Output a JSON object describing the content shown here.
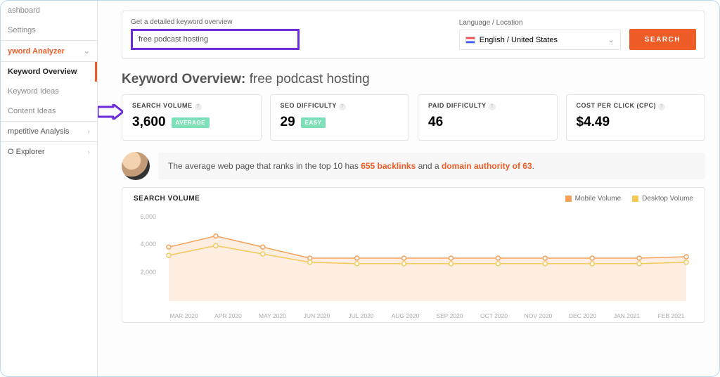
{
  "sidebar": {
    "items": [
      {
        "label": "ashboard"
      },
      {
        "label": "Settings"
      },
      {
        "label": "yword Analyzer"
      },
      {
        "label": "Keyword Overview"
      },
      {
        "label": "Keyword Ideas"
      },
      {
        "label": "Content Ideas"
      },
      {
        "label": "mpetitive Analysis"
      },
      {
        "label": "O Explorer"
      }
    ]
  },
  "search": {
    "prompt": "Get a detailed keyword overview",
    "value": "free podcast hosting",
    "lang_label": "Language / Location",
    "lang_value": "English / United States",
    "button": "SEARCH"
  },
  "heading": {
    "prefix": "Keyword Overview:",
    "kw": "free podcast hosting"
  },
  "cards": {
    "volume": {
      "title": "SEARCH VOLUME",
      "value": "3,600",
      "badge": "AVERAGE"
    },
    "seo": {
      "title": "SEO DIFFICULTY",
      "value": "29",
      "badge": "EASY"
    },
    "paid": {
      "title": "PAID DIFFICULTY",
      "value": "46"
    },
    "cpc": {
      "title": "COST PER CLICK (CPC)",
      "value": "$4.49"
    }
  },
  "tip": {
    "pre": "The average web page that ranks in the top 10 has ",
    "bold1": "655 backlinks",
    "mid": " and a ",
    "bold2": "domain authority of 63",
    "post": "."
  },
  "chart": {
    "title": "SEARCH VOLUME",
    "legend": [
      "Mobile Volume",
      "Desktop Volume"
    ]
  },
  "chart_data": {
    "type": "line",
    "xlabel": "",
    "ylabel": "",
    "ylim": [
      0,
      6000
    ],
    "yticks": [
      2000,
      4000,
      6000
    ],
    "categories": [
      "MAR 2020",
      "APR 2020",
      "MAY 2020",
      "JUN 2020",
      "JUL 2020",
      "AUG 2020",
      "SEP 2020",
      "OCT 2020",
      "NOV 2020",
      "DEC 2020",
      "JAN 2021",
      "FEB 2021"
    ],
    "series": [
      {
        "name": "Mobile Volume",
        "color": "#f5a15a",
        "values": [
          3800,
          4600,
          3800,
          3000,
          3000,
          3000,
          3000,
          3000,
          3000,
          3000,
          3000,
          3100
        ]
      },
      {
        "name": "Desktop Volume",
        "color": "#f4c95a",
        "values": [
          3200,
          3900,
          3300,
          2700,
          2600,
          2600,
          2600,
          2600,
          2600,
          2600,
          2600,
          2700
        ]
      }
    ]
  }
}
